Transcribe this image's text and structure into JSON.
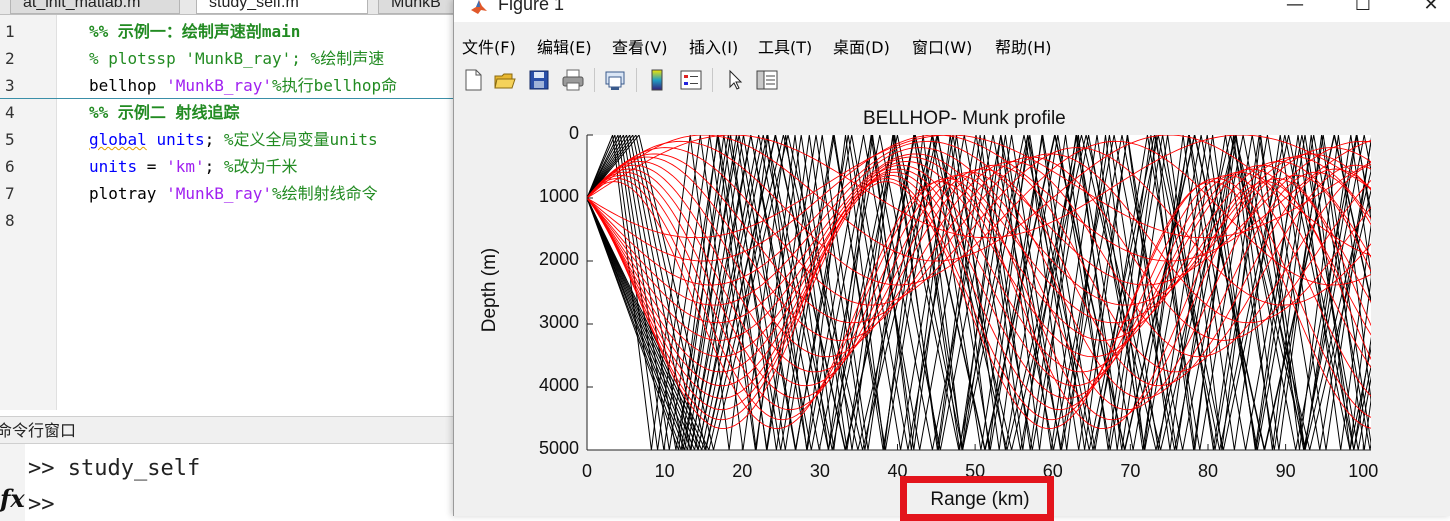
{
  "editor": {
    "tabs": [
      "at_init_matlab.m",
      "study_self.m",
      "MunkB"
    ],
    "active_tab": 1,
    "line_numbers": [
      "1",
      "2",
      "3",
      "4",
      "5",
      "6",
      "7",
      "8"
    ],
    "lines": [
      [
        {
          "t": "%% 示例一：绘制声速剖",
          "c": "sect"
        },
        {
          "t": "main",
          "c": "sect"
        }
      ],
      [
        {
          "t": "% plotssp 'MunkB_ray'; %绘制声速",
          "c": "comment"
        }
      ],
      [
        {
          "t": "bellhop ",
          "c": "plain"
        },
        {
          "t": "'MunkB_ray'",
          "c": "str"
        },
        {
          "t": "%执行bellhop命",
          "c": "comment"
        }
      ],
      [
        {
          "t": "%% 示例二 射线追踪",
          "c": "sect"
        }
      ],
      [
        {
          "t": "global",
          "c": "kw"
        },
        {
          "t": " ",
          "c": "plain"
        },
        {
          "t": "units",
          "c": "kw"
        },
        {
          "t": "; ",
          "c": "plain"
        },
        {
          "t": "%定义全局变量units",
          "c": "comment"
        }
      ],
      [
        {
          "t": "units",
          "c": "kw"
        },
        {
          "t": " = ",
          "c": "plain"
        },
        {
          "t": "'km'",
          "c": "str"
        },
        {
          "t": "; ",
          "c": "plain"
        },
        {
          "t": "%改为千米",
          "c": "comment"
        }
      ],
      [
        {
          "t": "plotray ",
          "c": "plain"
        },
        {
          "t": "'MunkB_ray'",
          "c": "str"
        },
        {
          "t": "%绘制射线命令",
          "c": "comment"
        }
      ],
      []
    ]
  },
  "command_window": {
    "title": "命令行窗口",
    "history": ">> study_self",
    "prompt": ">>",
    "fx": "fx"
  },
  "figure": {
    "title": "Figure 1",
    "window_buttons": {
      "minimize": "—",
      "maximize": "☐",
      "close": "✕"
    },
    "menus": [
      "文件(F)",
      "编辑(E)",
      "查看(V)",
      "插入(I)",
      "工具(T)",
      "桌面(D)",
      "窗口(W)",
      "帮助(H)"
    ],
    "toolbar_icons": [
      "new-figure-icon",
      "open-file-icon",
      "save-icon",
      "print-icon",
      "link-figure-icon",
      "insert-colorbar-icon",
      "insert-legend-icon",
      "pointer-icon",
      "property-editor-icon"
    ],
    "colors": {
      "ray_black": "#000000",
      "ray_red": "#ff0000",
      "highlight": "#e3141c"
    }
  },
  "chart_data": {
    "type": "line",
    "title": "BELLHOP- Munk profile",
    "xlabel": "Range (km)",
    "ylabel": "Depth (m)",
    "xlim": [
      0,
      101
    ],
    "ylim": [
      5000,
      0
    ],
    "y_reversed": true,
    "xticks": [
      0,
      10,
      20,
      30,
      40,
      50,
      60,
      70,
      80,
      90,
      100
    ],
    "yticks": [
      0,
      1000,
      2000,
      3000,
      4000,
      5000
    ],
    "source": {
      "range_km": 0,
      "depth_m": 1000
    },
    "series": [
      {
        "color": "red",
        "kind": "refracted",
        "rays": [
          {
            "ytop": 0,
            "ybot": 1630,
            "period": 65.5
          },
          {
            "ytop": 0,
            "ybot": 2000,
            "period": 60
          },
          {
            "ytop": 100,
            "ybot": 2380,
            "period": 56
          },
          {
            "ytop": 200,
            "ybot": 2700,
            "period": 53
          },
          {
            "ytop": 300,
            "ybot": 2980,
            "period": 51
          },
          {
            "ytop": 350,
            "ybot": 3260,
            "period": 49.5
          },
          {
            "ytop": 420,
            "ybot": 3520,
            "period": 48
          },
          {
            "ytop": 480,
            "ybot": 3760,
            "period": 46.5
          },
          {
            "ytop": 540,
            "ybot": 3980,
            "period": 45.5
          },
          {
            "ytop": 590,
            "ybot": 4180,
            "period": 44.5
          },
          {
            "ytop": 640,
            "ybot": 4360,
            "period": 43.5
          },
          {
            "ytop": 690,
            "ybot": 4520,
            "period": 42.5
          },
          {
            "ytop": 740,
            "ybot": 4660,
            "period": 42
          }
        ]
      },
      {
        "color": "black",
        "kind": "surface-bottom bouncing",
        "rays": [
          {
            "first_surface_range": 3.3,
            "period": 10.0
          },
          {
            "first_surface_range": 3.6,
            "period": 11.0
          },
          {
            "first_surface_range": 4.0,
            "period": 11.8
          },
          {
            "first_surface_range": 4.3,
            "period": 12.6
          },
          {
            "first_surface_range": 4.7,
            "period": 13.5
          },
          {
            "first_surface_range": 5.1,
            "period": 14.5
          },
          {
            "first_surface_range": 5.5,
            "period": 15.6
          },
          {
            "first_surface_range": 5.9,
            "period": 16.8
          },
          {
            "first_surface_range": 6.3,
            "period": 18.0
          },
          {
            "first_surface_range": 6.7,
            "period": 19.2
          }
        ]
      }
    ],
    "annotation": {
      "type": "highlight-box",
      "target": "xlabel"
    }
  }
}
